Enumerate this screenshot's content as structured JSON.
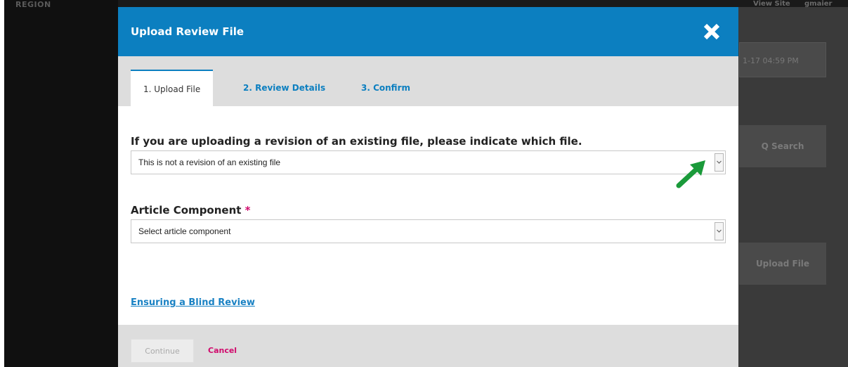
{
  "background": {
    "brand": "REGION",
    "top_items": [
      "View Site",
      "gmaier"
    ],
    "date": "1-17 04:59 PM",
    "search_button": "Q Search",
    "upload_button": "Upload File"
  },
  "modal": {
    "title": "Upload Review File",
    "close_icon": "close-icon",
    "tabs": [
      {
        "label": "1. Upload File",
        "active": true
      },
      {
        "label": "2. Review Details",
        "active": false
      },
      {
        "label": "3. Confirm",
        "active": false
      }
    ],
    "revision_field": {
      "label": "If you are uploading a revision of an existing file, please indicate which file.",
      "value": "This is not a revision of an existing file"
    },
    "component_field": {
      "label": "Article Component",
      "required_mark": "*",
      "value": "Select article component"
    },
    "blind_review_link": "Ensuring a Blind Review",
    "footer": {
      "continue_label": "Continue",
      "cancel_label": "Cancel"
    }
  },
  "colors": {
    "header": "#0c7fc0",
    "accent_link": "#1a82c4",
    "cancel": "#d00a6c",
    "annotation_arrow": "#1a9a3a"
  }
}
